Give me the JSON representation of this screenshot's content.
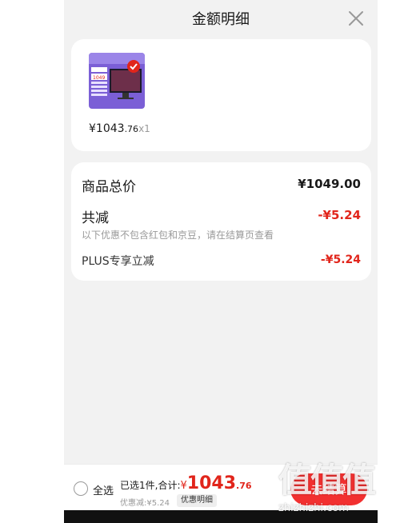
{
  "header": {
    "title": "金额明细"
  },
  "product": {
    "thumb_price_text": "1049",
    "price_currency": "¥",
    "price_integer": "1043",
    "price_decimal": ".76",
    "quantity": "x1"
  },
  "summary": {
    "total_label": "商品总价",
    "total_value": "¥1049.00",
    "reduce_label": "共减",
    "reduce_value": "-¥5.24",
    "note": "以下优惠不包含红包和京豆，请在结算页查看",
    "plus_label": "PLUS专享立减",
    "plus_value": "-¥5.24"
  },
  "footer": {
    "select_all": "全选",
    "selected_text": "已选1件,合计:",
    "currency": "¥",
    "total_integer": "1043",
    "total_decimal": ".76",
    "discount_text": "优惠减:¥5.24",
    "detail_label": "优惠明细",
    "checkout_label": "去结算"
  },
  "watermark": {
    "logo": "值值值",
    "url": "zhizhizhi.com"
  },
  "colors": {
    "accent_red": "#e1251b",
    "button_red": "#f23030",
    "sheet_bg": "#f2f2f2"
  }
}
